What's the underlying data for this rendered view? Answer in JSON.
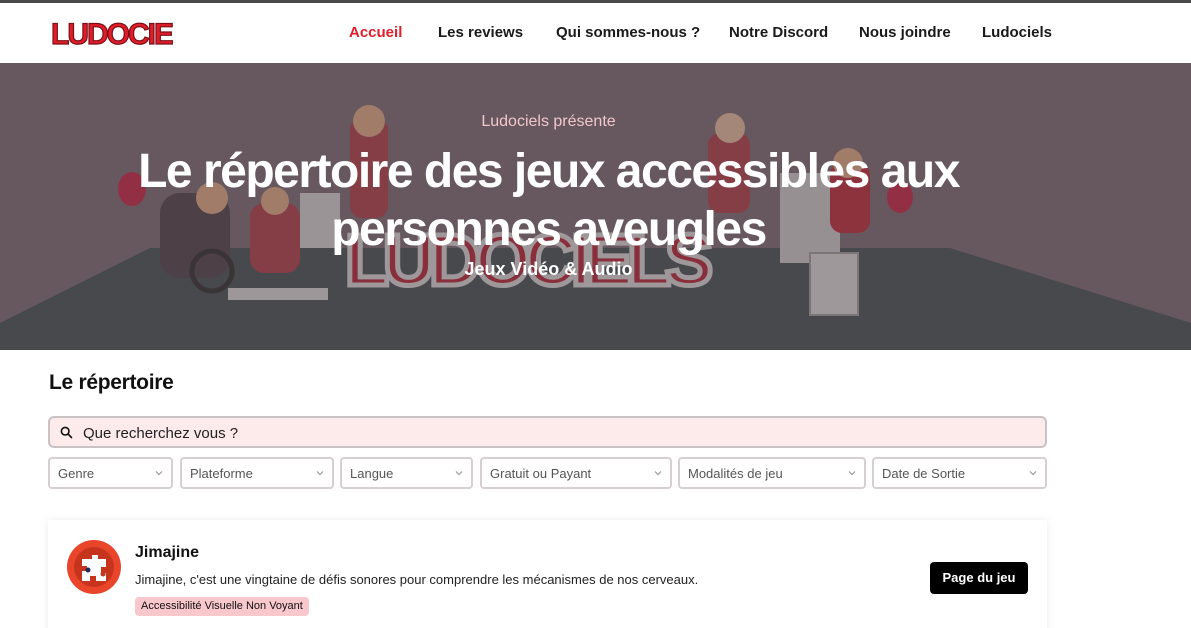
{
  "header": {
    "logo_text": "Ludociels",
    "nav": [
      {
        "label": "Accueil",
        "active": true
      },
      {
        "label": "Les reviews"
      },
      {
        "label": "Qui sommes-nous ?"
      },
      {
        "label": "Notre Discord"
      },
      {
        "label": "Nous joindre"
      },
      {
        "label": "Ludociels"
      }
    ]
  },
  "hero": {
    "pretitle": "Ludociels présente",
    "title": "Le répertoire des jeux accessibles aux personnes aveugles",
    "subtitle": "Jeux Vidéo & Audio"
  },
  "directory": {
    "title": "Le répertoire",
    "search": {
      "placeholder": "Que recherchez vous ?",
      "icon": "search-icon"
    },
    "filters": [
      {
        "label": "Genre"
      },
      {
        "label": "Plateforme"
      },
      {
        "label": "Langue"
      },
      {
        "label": "Gratuit ou Payant"
      },
      {
        "label": "Modalités de jeu"
      },
      {
        "label": "Date de Sortie"
      }
    ]
  },
  "games": [
    {
      "name": "Jimajine",
      "description": "Jimajine, c'est une vingtaine de défis sonores pour comprendre les mécanismes de nos cerveaux.",
      "tag": "Accessibilité Visuelle Non Voyant",
      "button": "Page du jeu"
    }
  ],
  "colors": {
    "accent": "#e11d2a",
    "tag_bg": "#f8c8cc",
    "search_bg": "#fdeaea",
    "hero_bg": "#6d5d63"
  }
}
